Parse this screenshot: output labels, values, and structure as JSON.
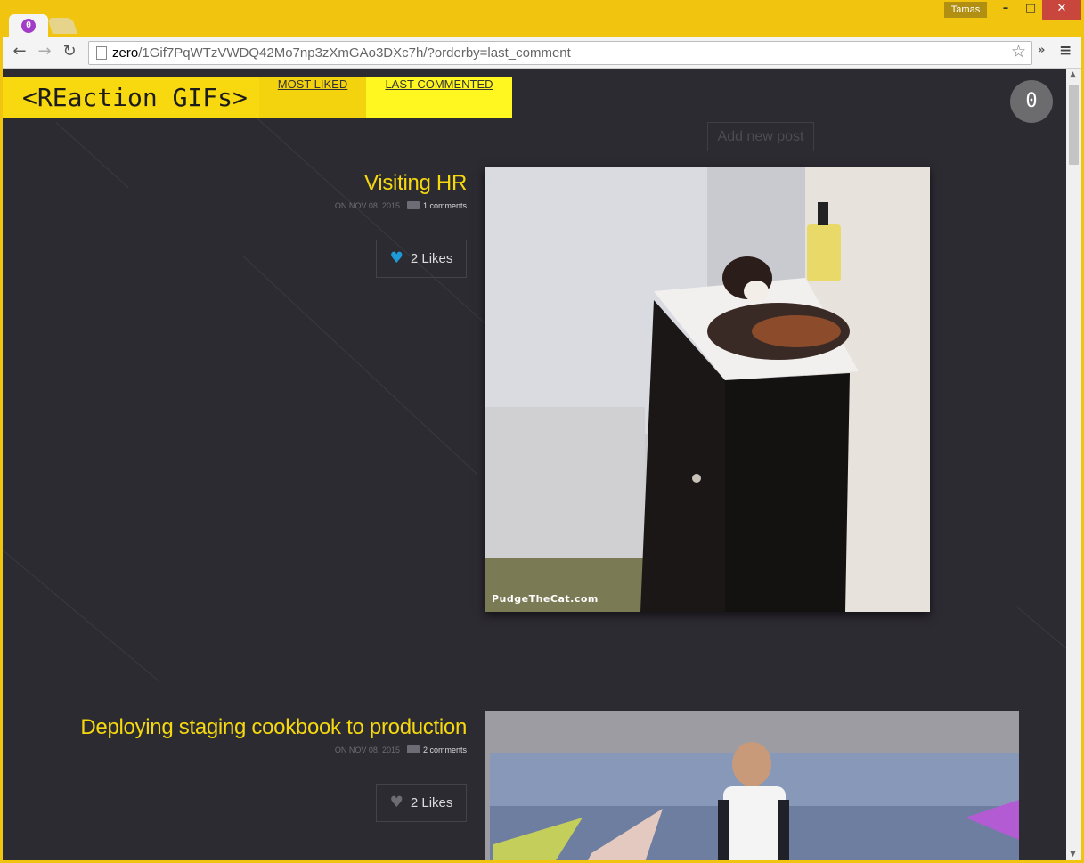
{
  "browser": {
    "tab_favicon": "0",
    "user_name": "Tamas",
    "window_controls": {
      "minimize": "–",
      "maximize": "□",
      "close": "✕"
    },
    "url_host": "zero",
    "url_path": "/1Gif7PqWTzVWDQ42Mo7np3zXmGAo3DXc7h/?orderby=last_comment",
    "icons": [
      "back-icon",
      "forward-icon",
      "reload-icon",
      "page-icon",
      "star-icon",
      "extensions-icon",
      "menu-icon"
    ]
  },
  "site": {
    "logo": "<REaction GIFs>",
    "nav": {
      "most_liked": "MOST LIKED",
      "last_commented": "LAST COMMENTED"
    },
    "peer_count": "0",
    "add_post": "Add new post",
    "colors": {
      "accent": "#f5d90e",
      "background": "#2d2b32",
      "like_active": "#1e9ad8",
      "like_inactive": "#6d6b73"
    }
  },
  "posts": [
    {
      "title": "Visiting HR",
      "date": "ON NOV 08, 2015",
      "comments": "1 comments",
      "likes": "2 Likes",
      "liked": true,
      "image_watermark": "PudgeTheCat.com"
    },
    {
      "title": "Deploying staging cookbook to production",
      "date": "ON NOV 08, 2015",
      "comments": "2 comments",
      "likes": "2 Likes",
      "liked": false
    }
  ]
}
